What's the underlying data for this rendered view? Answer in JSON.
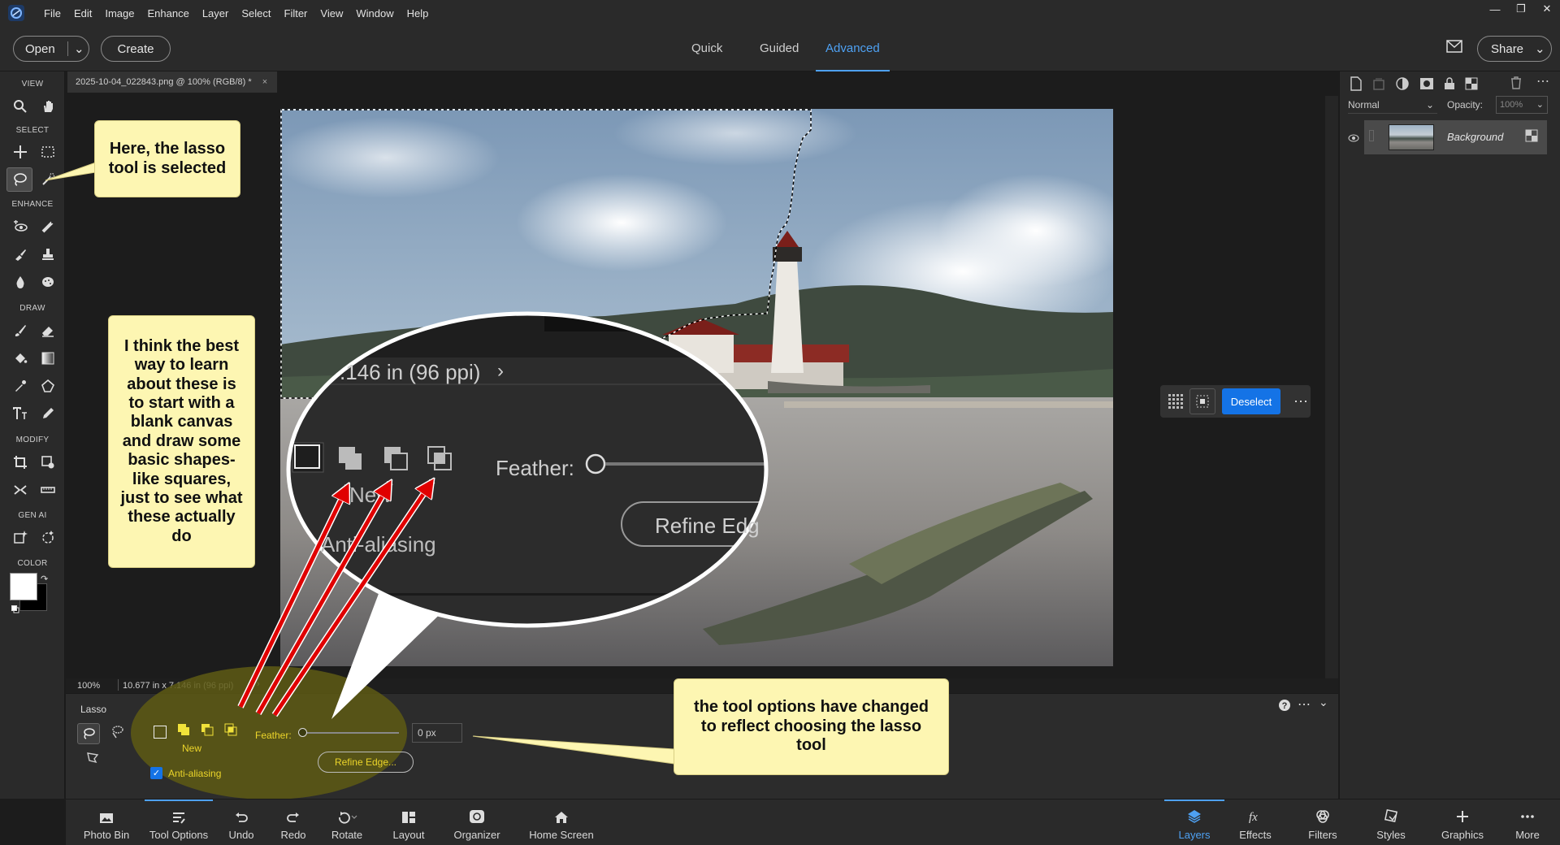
{
  "menubar": {
    "items": [
      "File",
      "Edit",
      "Image",
      "Enhance",
      "Layer",
      "Select",
      "Filter",
      "View",
      "Window",
      "Help"
    ],
    "window_controls": [
      "minimize-icon",
      "restore-icon",
      "close-icon"
    ]
  },
  "modebar": {
    "open_label": "Open",
    "create_label": "Create",
    "tabs": [
      "Quick",
      "Guided",
      "Advanced"
    ],
    "active_tab": "Advanced",
    "share_label": "Share"
  },
  "toolbox": {
    "sections": {
      "view": "VIEW",
      "select": "SELECT",
      "enhance": "ENHANCE",
      "draw": "DRAW",
      "modify": "MODIFY",
      "gen_ai": "GEN AI",
      "color": "COLOR"
    },
    "selected_tool": "lasso-tool"
  },
  "document": {
    "tab_title": "2025-10-04_022843.png @ 100% (RGB/8) *",
    "zoom": "100%",
    "dimensions": "10.677 in x 7.146 in (96 ppi)"
  },
  "taskbar": {
    "deselect_label": "Deselect"
  },
  "layers_panel": {
    "blend_mode": "Normal",
    "opacity_label": "Opacity:",
    "opacity_value": "100%",
    "layer_name": "Background"
  },
  "tool_options": {
    "tool_name": "Lasso",
    "new_label": "New",
    "feather_label": "Feather:",
    "feather_value": "0 px",
    "anti_aliasing_label": "Anti-aliasing",
    "anti_aliasing_checked": true,
    "refine_edge_label": "Refine Edge..."
  },
  "magnifier": {
    "dimensions_text": ".146 in (96 ppi)",
    "feather_label": "Feather:",
    "new_label": "New",
    "anti_aliasing_label": "Anti-aliasing",
    "refine_label": "Refine Edg"
  },
  "bottombar": {
    "left": [
      "Photo Bin",
      "Tool Options",
      "Undo",
      "Redo",
      "Rotate",
      "Layout",
      "Organizer",
      "Home Screen"
    ],
    "right": [
      "Layers",
      "Effects",
      "Filters",
      "Styles",
      "Graphics",
      "More"
    ],
    "active_left": "Tool Options",
    "active_right": "Layers"
  },
  "callouts": {
    "lasso_selected": "Here, the lasso tool is selected",
    "best_way": "I think the best way to learn about these is to start with a blank canvas and draw some basic shapes- like squares, just to see what these actually do",
    "tool_options_changed": "the tool options have changed to reflect choosing the lasso tool"
  },
  "colors": {
    "accent": "#4ea1f3",
    "deselect_bg": "#1473e6",
    "callout_bg": "#fdf6b2",
    "highlight_olive": "#5e5a14",
    "arrow_red": "#e00000"
  }
}
